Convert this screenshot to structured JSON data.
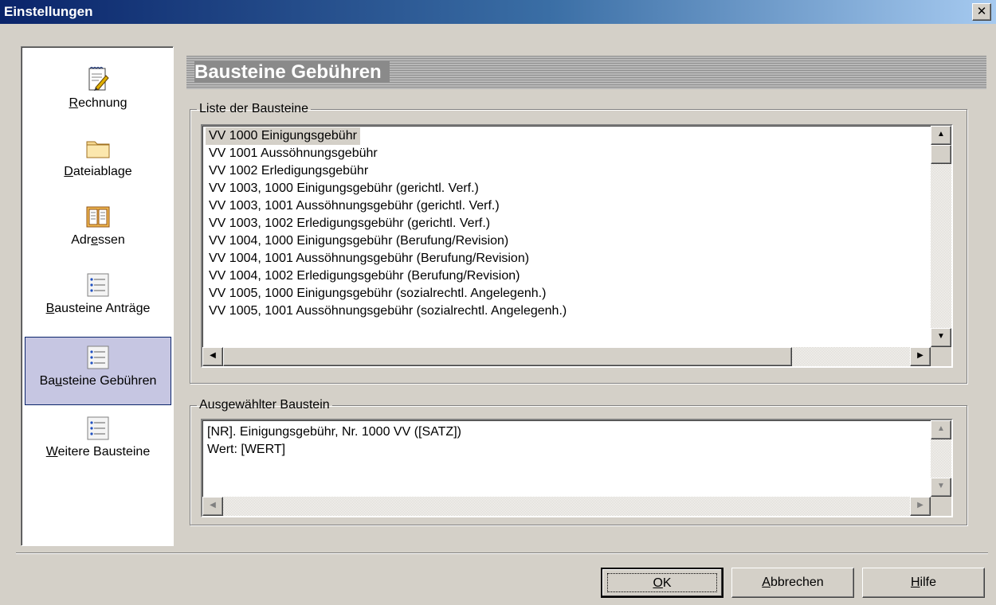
{
  "window": {
    "title": "Einstellungen",
    "close_glyph": "✕"
  },
  "sidebar": {
    "items": [
      {
        "pre": "",
        "accel": "R",
        "post": "echnung",
        "icon": "invoice-icon",
        "selected": false
      },
      {
        "pre": "",
        "accel": "D",
        "post": "ateiablage",
        "icon": "folder-icon",
        "selected": false
      },
      {
        "pre": "Adr",
        "accel": "e",
        "post": "ssen",
        "icon": "address-book-icon",
        "selected": false
      },
      {
        "pre": "",
        "accel": "B",
        "post": "austeine Anträge",
        "icon": "text-block-icon",
        "selected": false
      },
      {
        "pre": "Ba",
        "accel": "u",
        "post": "steine Gebühren",
        "icon": "text-block-icon",
        "selected": true
      },
      {
        "pre": "",
        "accel": "W",
        "post": "eitere Bausteine",
        "icon": "text-block-icon",
        "selected": false
      }
    ]
  },
  "main": {
    "header_title": "Bausteine Gebühren",
    "list_group_label": "Liste der Bausteine",
    "list_items": [
      "VV 1000 Einigungsgebühr",
      "VV 1001 Aussöhnungsgebühr",
      "VV 1002 Erledigungsgebühr",
      "VV 1003, 1000 Einigungsgebühr (gerichtl. Verf.)",
      "VV 1003, 1001 Aussöhnungsgebühr (gerichtl. Verf.)",
      "VV 1003, 1002 Erledigungsgebühr (gerichtl. Verf.)",
      "VV 1004, 1000 Einigungsgebühr (Berufung/Revision)",
      "VV 1004, 1001 Aussöhnungsgebühr (Berufung/Revision)",
      "VV 1004, 1002 Erledigungsgebühr (Berufung/Revision)",
      "VV 1005, 1000 Einigungsgebühr (sozialrechtl. Angelegenh.)",
      "VV 1005, 1001 Aussöhnungsgebühr (sozialrechtl. Angelegenh.)"
    ],
    "selected_index": 0,
    "selected_group_label": "Ausgewählter Baustein",
    "selected_text_line1": "[NR]. Einigungsgebühr, Nr. 1000 VV ([SATZ])",
    "selected_text_line2": "Wert: [WERT]"
  },
  "buttons": {
    "ok": {
      "pre": "",
      "accel": "O",
      "post": "K"
    },
    "cancel": {
      "pre": "",
      "accel": "A",
      "post": "bbrechen"
    },
    "help": {
      "pre": "",
      "accel": "H",
      "post": "ilfe"
    }
  },
  "scroll": {
    "up": "▲",
    "down": "▼",
    "left": "◀",
    "right": "▶"
  }
}
